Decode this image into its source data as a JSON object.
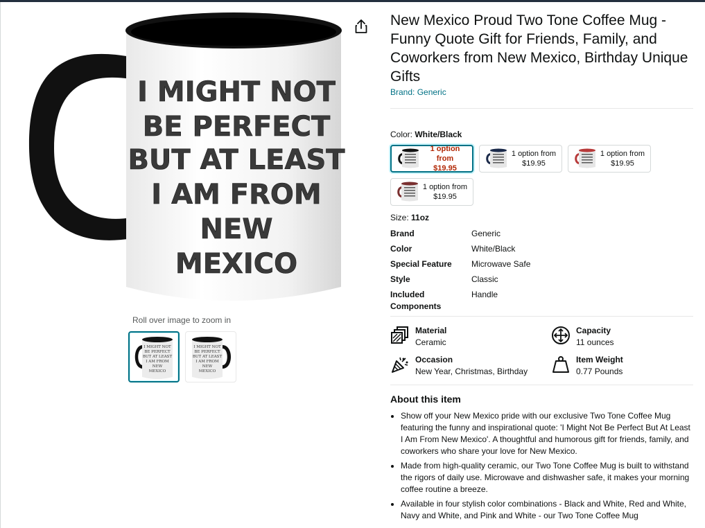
{
  "product": {
    "title": "New Mexico Proud Two Tone Coffee Mug - Funny Quote Gift for Friends, Family, and Coworkers from New Mexico, Birthday Unique Gifts",
    "brand_link": "Brand: Generic"
  },
  "image": {
    "mug_text": [
      "I MIGHT NOT",
      "BE PERFECT",
      "BUT AT LEAST",
      "I AM FROM",
      "NEW",
      "MEXICO"
    ],
    "zoom_hint": "Roll over image to zoom in",
    "thumb_text": [
      "I MIGHT NOT",
      "BE PERFECT",
      "BUT AT LEAST",
      "I AM FROM",
      "NEW",
      "MEXICO"
    ]
  },
  "color": {
    "label": "Color: ",
    "value": "White/Black",
    "options": [
      {
        "line1": "1 option from",
        "line2": "$19.95",
        "accent": "#111111",
        "inside": "#111111"
      },
      {
        "line1": "1 option from",
        "line2": "$19.95",
        "accent": "#1b2a4a",
        "inside": "#1b2a4a"
      },
      {
        "line1": "1 option from",
        "line2": "$19.95",
        "accent": "#b73a3a",
        "inside": "#b73a3a"
      },
      {
        "line1": "1 option from",
        "line2": "$19.95",
        "accent": "#7a3030",
        "inside": "#7a3030"
      }
    ]
  },
  "size": {
    "label": "Size: ",
    "value": "11oz"
  },
  "specs": [
    {
      "k": "Brand",
      "v": "Generic"
    },
    {
      "k": "Color",
      "v": "White/Black"
    },
    {
      "k": "Special Feature",
      "v": "Microwave Safe"
    },
    {
      "k": "Style",
      "v": "Classic"
    },
    {
      "k": "Included Components",
      "v": "Handle"
    }
  ],
  "features": [
    {
      "label": "Material",
      "value": "Ceramic",
      "icon": "material-icon"
    },
    {
      "label": "Capacity",
      "value": "11 ounces",
      "icon": "capacity-icon"
    },
    {
      "label": "Occasion",
      "value": "New Year, Christmas, Birthday",
      "icon": "occasion-icon"
    },
    {
      "label": "Item Weight",
      "value": "0.77 Pounds",
      "icon": "weight-icon"
    }
  ],
  "about": {
    "heading": "About this item",
    "bullets": [
      "Show off your New Mexico pride with our exclusive Two Tone Coffee Mug featuring the funny and inspirational quote: 'I Might Not Be Perfect But At Least I Am From New Mexico'. A thoughtful and humorous gift for friends, family, and coworkers who share your love for New Mexico.",
      "Made from high-quality ceramic, our Two Tone Coffee Mug is built to withstand the rigors of daily use. Microwave and dishwasher safe, it makes your morning coffee routine a breeze.",
      "Available in four stylish color combinations - Black and White, Red and White, Navy and White, and Pink and White - our Two Tone Coffee Mug"
    ]
  },
  "colors": {
    "accent": "#007185",
    "price_red": "#b12704",
    "text": "#0f1111"
  }
}
